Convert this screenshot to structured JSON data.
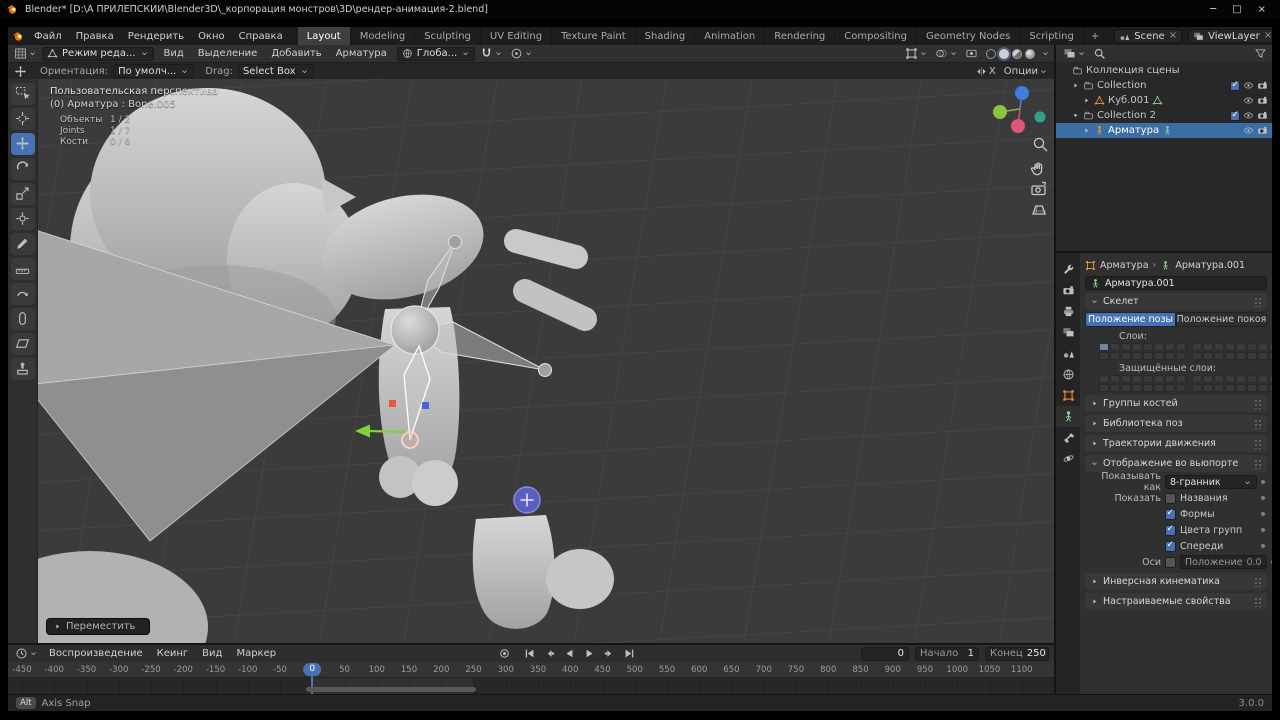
{
  "window": {
    "title": "Blender* [D:\\А ПРИЛЕПСКИЙ\\Blender3D\\_корпорация монстров\\3D\\рендер-анимация-2.blend]",
    "controls": {
      "minimize": "─",
      "maximize": "□",
      "close": "×"
    }
  },
  "menubar": {
    "menus": [
      "Файл",
      "Правка",
      "Рендерить",
      "Окно",
      "Справка"
    ],
    "menu_ids": [
      "file",
      "edit",
      "render",
      "window",
      "help"
    ],
    "workspaces": [
      "Layout",
      "Modeling",
      "Sculpting",
      "UV Editing",
      "Texture Paint",
      "Shading",
      "Animation",
      "Rendering",
      "Compositing",
      "Geometry Nodes",
      "Scripting"
    ],
    "active_workspace": "Layout",
    "add_tab": "+",
    "scene_label": "Scene",
    "view_layer_label": "ViewLayer"
  },
  "viewport_header": {
    "mode": "Режим реда...",
    "menus": [
      "Вид",
      "Выделение",
      "Добавить",
      "Арматура"
    ],
    "menu_ids": [
      "view",
      "select",
      "add",
      "armature"
    ],
    "orientation": "Глоба..."
  },
  "tool_settings": {
    "orientation_label": "Ориентация:",
    "orientation_value": "По умолч...",
    "drag_label": "Drag:",
    "drag_value": "Select Box",
    "mirror_label": "X",
    "options_label": "Опции"
  },
  "toolbar": {
    "active": "move",
    "tools": [
      {
        "id": "select-box"
      },
      {
        "id": "cursor3d"
      },
      {
        "id": "move"
      },
      {
        "id": "rotate"
      },
      {
        "id": "scale"
      },
      {
        "id": "transform"
      },
      {
        "id": "annotate"
      },
      {
        "id": "measure"
      },
      {
        "id": "roll"
      },
      {
        "id": "bone-envelope"
      },
      {
        "id": "shear"
      },
      {
        "id": "extrude"
      }
    ]
  },
  "viewport": {
    "view_label": "Пользовательская перспектива",
    "active_item": "(0) Арматура : Bone.005",
    "stats": [
      {
        "label": "Объекты",
        "value": "1 / 2"
      },
      {
        "label": "Joints",
        "value": "1 / 7"
      },
      {
        "label": "Кости",
        "value": "0 / 6"
      }
    ],
    "operator": "Переместить"
  },
  "outliner": {
    "rows": [
      {
        "id": "scene-collection",
        "label": "Коллекция сцены",
        "icon": "collection",
        "indent": 0,
        "expand": "none",
        "toggles": []
      },
      {
        "id": "collection",
        "label": "Collection",
        "icon": "collection",
        "indent": 1,
        "expand": "closed",
        "toggles": [
          "check",
          "eye",
          "camera"
        ]
      },
      {
        "id": "cube-001",
        "label": "Куб.001",
        "icon": "mesh",
        "icon_color": "c-orange",
        "indent": 2,
        "expand": "closed",
        "extras": [
          "mesh"
        ],
        "toggles": [
          "eye",
          "camera"
        ]
      },
      {
        "id": "collection-2",
        "label": "Collection 2",
        "icon": "collection",
        "indent": 1,
        "expand": "open",
        "toggles": [
          "check",
          "eye",
          "camera"
        ]
      },
      {
        "id": "armature",
        "label": "Арматура",
        "icon": "armature",
        "icon_color": "c-orange",
        "indent": 2,
        "expand": "closed",
        "selected": true,
        "extras": [
          "armature"
        ],
        "toggles": [
          "eye",
          "camera"
        ]
      }
    ]
  },
  "properties": {
    "tabs": [
      "tool",
      "render",
      "output",
      "view-layer",
      "scene",
      "world",
      "object",
      "data",
      "bone",
      "physics"
    ],
    "active_tab": "data",
    "breadcrumb": {
      "object": "Арматура",
      "data": "Арматура.001"
    },
    "name_value": "Арматура.001",
    "panels": {
      "skeleton_title": "Скелет",
      "pose_position": "Положение позы",
      "rest_position": "Положение покоя",
      "layers_label": "Слои:",
      "protected_label": "Защищённые слои:",
      "collapsed_top": [
        {
          "id": "bone-groups",
          "label": "Группы костей"
        },
        {
          "id": "pose-library",
          "label": "Библиотека поз"
        },
        {
          "id": "motion-paths",
          "label": "Траектории движения"
        }
      ],
      "display_title": "Отображение во вьюпорте",
      "display_as_label": "Показывать как",
      "display_as_value": "8-гранник",
      "show_label": "Показать",
      "show_items": [
        {
          "id": "names",
          "label": "Названия",
          "checked": false
        },
        {
          "id": "shapes",
          "label": "Формы",
          "checked": true
        },
        {
          "id": "group-colors",
          "label": "Цвета групп",
          "checked": true
        },
        {
          "id": "in-front",
          "label": "Спереди",
          "checked": true
        }
      ],
      "axes_label": "Оси",
      "axes_checked": false,
      "position_label": "Положение",
      "position_value": "0.0",
      "collapsed_bottom": [
        {
          "id": "inverse-kinematics",
          "label": "Инверсная кинематика"
        },
        {
          "id": "custom-properties",
          "label": "Настраиваемые свойства"
        }
      ]
    }
  },
  "timeline": {
    "menus": [
      "Воспроизведение",
      "Кеинг",
      "Вид",
      "Маркер"
    ],
    "menu_ids": [
      "playback",
      "keying",
      "view",
      "marker"
    ],
    "current_frame": 0,
    "start_label": "Начало",
    "start_value": "1",
    "end_label": "Конец",
    "end_value": "250",
    "ruler": {
      "min": -450,
      "max": 1100,
      "step": 50
    }
  },
  "statusbar": {
    "key": "Alt",
    "action": "Axis Snap",
    "version": "3.0.0"
  },
  "colors": {
    "accent": "#4772b3",
    "selection": "#3a6ea5",
    "object_orange": "#e8953d",
    "data_green": "#8fd08f"
  }
}
